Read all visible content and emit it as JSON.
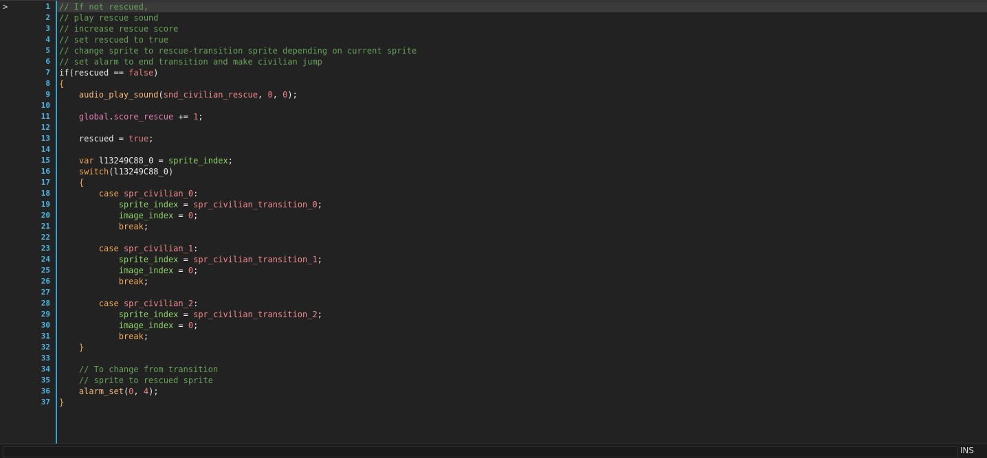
{
  "editor": {
    "gutter_marker": ">",
    "lines": [
      {
        "n": "1",
        "tokens": [
          {
            "t": "// If not rescued,",
            "k": "comment"
          }
        ]
      },
      {
        "n": "2",
        "tokens": [
          {
            "t": "// play rescue sound",
            "k": "comment"
          }
        ]
      },
      {
        "n": "3",
        "tokens": [
          {
            "t": "// increase rescue score",
            "k": "comment"
          }
        ]
      },
      {
        "n": "4",
        "tokens": [
          {
            "t": "// set rescued to true",
            "k": "comment"
          }
        ]
      },
      {
        "n": "5",
        "tokens": [
          {
            "t": "// change sprite to rescue-transition sprite depending on current sprite",
            "k": "comment"
          }
        ]
      },
      {
        "n": "6",
        "tokens": [
          {
            "t": "// set alarm to end transition and make civilian jump",
            "k": "comment"
          }
        ]
      },
      {
        "n": "7",
        "tokens": [
          {
            "t": "if",
            "k": "ident"
          },
          {
            "t": "(rescued == ",
            "k": "punct"
          },
          {
            "t": "false",
            "k": "lit"
          },
          {
            "t": ")",
            "k": "punct"
          }
        ]
      },
      {
        "n": "8",
        "tokens": [
          {
            "t": "{",
            "k": "brace"
          }
        ]
      },
      {
        "n": "9",
        "tokens": [
          {
            "t": "    ",
            "k": "punct"
          },
          {
            "t": "audio_play_sound",
            "k": "builtin"
          },
          {
            "t": "(",
            "k": "punct"
          },
          {
            "t": "snd_civilian_rescue",
            "k": "asset"
          },
          {
            "t": ", ",
            "k": "punct"
          },
          {
            "t": "0",
            "k": "num"
          },
          {
            "t": ", ",
            "k": "punct"
          },
          {
            "t": "0",
            "k": "num"
          },
          {
            "t": ");",
            "k": "punct"
          }
        ]
      },
      {
        "n": "10",
        "tokens": []
      },
      {
        "n": "11",
        "tokens": [
          {
            "t": "    ",
            "k": "punct"
          },
          {
            "t": "global",
            "k": "global"
          },
          {
            "t": ".",
            "k": "punct"
          },
          {
            "t": "score_rescue",
            "k": "prop"
          },
          {
            "t": " += ",
            "k": "punct"
          },
          {
            "t": "1",
            "k": "num"
          },
          {
            "t": ";",
            "k": "punct"
          }
        ]
      },
      {
        "n": "12",
        "tokens": []
      },
      {
        "n": "13",
        "tokens": [
          {
            "t": "    rescued = ",
            "k": "ident"
          },
          {
            "t": "true",
            "k": "lit"
          },
          {
            "t": ";",
            "k": "punct"
          }
        ]
      },
      {
        "n": "14",
        "tokens": []
      },
      {
        "n": "15",
        "tokens": [
          {
            "t": "    ",
            "k": "punct"
          },
          {
            "t": "var",
            "k": "kw"
          },
          {
            "t": " l13249C88_0 = ",
            "k": "ident"
          },
          {
            "t": "sprite_index",
            "k": "var"
          },
          {
            "t": ";",
            "k": "punct"
          }
        ]
      },
      {
        "n": "16",
        "tokens": [
          {
            "t": "    ",
            "k": "punct"
          },
          {
            "t": "switch",
            "k": "kw"
          },
          {
            "t": "(l13249C88_0)",
            "k": "ident"
          }
        ]
      },
      {
        "n": "17",
        "tokens": [
          {
            "t": "    ",
            "k": "punct"
          },
          {
            "t": "{",
            "k": "brace"
          }
        ]
      },
      {
        "n": "18",
        "tokens": [
          {
            "t": "        ",
            "k": "punct"
          },
          {
            "t": "case",
            "k": "kw"
          },
          {
            "t": " ",
            "k": "punct"
          },
          {
            "t": "spr_civilian_0",
            "k": "asset"
          },
          {
            "t": ":",
            "k": "punct"
          }
        ]
      },
      {
        "n": "19",
        "tokens": [
          {
            "t": "            ",
            "k": "punct"
          },
          {
            "t": "sprite_index",
            "k": "var"
          },
          {
            "t": " = ",
            "k": "punct"
          },
          {
            "t": "spr_civilian_transition_0",
            "k": "asset"
          },
          {
            "t": ";",
            "k": "punct"
          }
        ]
      },
      {
        "n": "20",
        "tokens": [
          {
            "t": "            ",
            "k": "punct"
          },
          {
            "t": "image_index",
            "k": "var"
          },
          {
            "t": " = ",
            "k": "punct"
          },
          {
            "t": "0",
            "k": "num"
          },
          {
            "t": ";",
            "k": "punct"
          }
        ]
      },
      {
        "n": "21",
        "tokens": [
          {
            "t": "            ",
            "k": "punct"
          },
          {
            "t": "break",
            "k": "kw"
          },
          {
            "t": ";",
            "k": "punct"
          }
        ]
      },
      {
        "n": "22",
        "tokens": []
      },
      {
        "n": "23",
        "tokens": [
          {
            "t": "        ",
            "k": "punct"
          },
          {
            "t": "case",
            "k": "kw"
          },
          {
            "t": " ",
            "k": "punct"
          },
          {
            "t": "spr_civilian_1",
            "k": "asset"
          },
          {
            "t": ":",
            "k": "punct"
          }
        ]
      },
      {
        "n": "24",
        "tokens": [
          {
            "t": "            ",
            "k": "punct"
          },
          {
            "t": "sprite_index",
            "k": "var"
          },
          {
            "t": " = ",
            "k": "punct"
          },
          {
            "t": "spr_civilian_transition_1",
            "k": "asset"
          },
          {
            "t": ";",
            "k": "punct"
          }
        ]
      },
      {
        "n": "25",
        "tokens": [
          {
            "t": "            ",
            "k": "punct"
          },
          {
            "t": "image_index",
            "k": "var"
          },
          {
            "t": " = ",
            "k": "punct"
          },
          {
            "t": "0",
            "k": "num"
          },
          {
            "t": ";",
            "k": "punct"
          }
        ]
      },
      {
        "n": "26",
        "tokens": [
          {
            "t": "            ",
            "k": "punct"
          },
          {
            "t": "break",
            "k": "kw"
          },
          {
            "t": ";",
            "k": "punct"
          }
        ]
      },
      {
        "n": "27",
        "tokens": []
      },
      {
        "n": "28",
        "tokens": [
          {
            "t": "        ",
            "k": "punct"
          },
          {
            "t": "case",
            "k": "kw"
          },
          {
            "t": " ",
            "k": "punct"
          },
          {
            "t": "spr_civilian_2",
            "k": "asset"
          },
          {
            "t": ":",
            "k": "punct"
          }
        ]
      },
      {
        "n": "29",
        "tokens": [
          {
            "t": "            ",
            "k": "punct"
          },
          {
            "t": "sprite_index",
            "k": "var"
          },
          {
            "t": " = ",
            "k": "punct"
          },
          {
            "t": "spr_civilian_transition_2",
            "k": "asset"
          },
          {
            "t": ";",
            "k": "punct"
          }
        ]
      },
      {
        "n": "30",
        "tokens": [
          {
            "t": "            ",
            "k": "punct"
          },
          {
            "t": "image_index",
            "k": "var"
          },
          {
            "t": " = ",
            "k": "punct"
          },
          {
            "t": "0",
            "k": "num"
          },
          {
            "t": ";",
            "k": "punct"
          }
        ]
      },
      {
        "n": "31",
        "tokens": [
          {
            "t": "            ",
            "k": "punct"
          },
          {
            "t": "break",
            "k": "kw"
          },
          {
            "t": ";",
            "k": "punct"
          }
        ]
      },
      {
        "n": "32",
        "tokens": [
          {
            "t": "    ",
            "k": "punct"
          },
          {
            "t": "}",
            "k": "brace"
          }
        ]
      },
      {
        "n": "33",
        "tokens": []
      },
      {
        "n": "34",
        "tokens": [
          {
            "t": "    ",
            "k": "punct"
          },
          {
            "t": "// To change from transition",
            "k": "comment"
          }
        ]
      },
      {
        "n": "35",
        "tokens": [
          {
            "t": "    ",
            "k": "punct"
          },
          {
            "t": "// sprite to rescued sprite",
            "k": "comment"
          }
        ]
      },
      {
        "n": "36",
        "tokens": [
          {
            "t": "    ",
            "k": "punct"
          },
          {
            "t": "alarm_set",
            "k": "builtin"
          },
          {
            "t": "(",
            "k": "punct"
          },
          {
            "t": "0",
            "k": "num"
          },
          {
            "t": ", ",
            "k": "punct"
          },
          {
            "t": "4",
            "k": "num"
          },
          {
            "t": ");",
            "k": "punct"
          }
        ]
      },
      {
        "n": "37",
        "tokens": [
          {
            "t": "}",
            "k": "brace"
          }
        ]
      }
    ]
  },
  "statusbar": {
    "mode": "INS",
    "field_value": ""
  }
}
